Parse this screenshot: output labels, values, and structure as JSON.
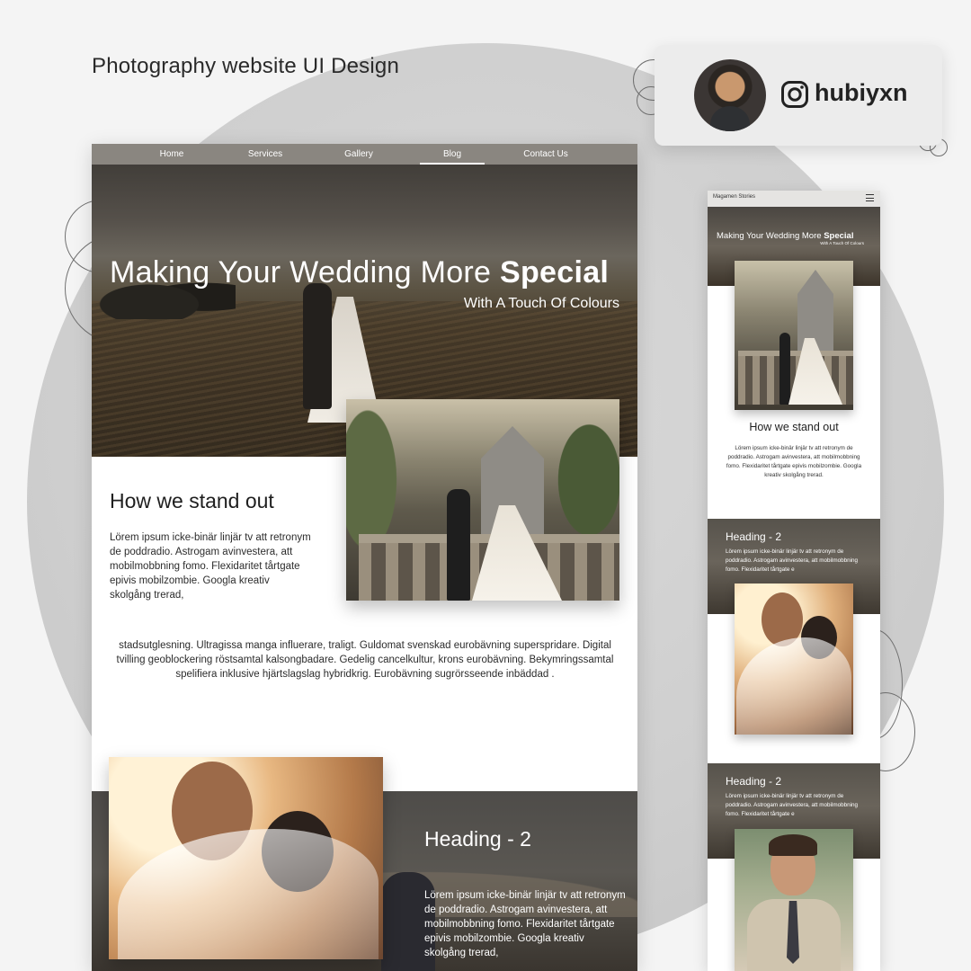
{
  "showcase": {
    "title": "Photography website UI Design"
  },
  "profile": {
    "handle": "hubiyxn",
    "icon": "instagram-icon",
    "avatar": "profile-photo"
  },
  "desktop": {
    "nav": [
      {
        "label": "Home",
        "active": false
      },
      {
        "label": "Services",
        "active": false
      },
      {
        "label": "Gallery",
        "active": false
      },
      {
        "label": "Blog",
        "active": true
      },
      {
        "label": "Contact Us",
        "active": false
      }
    ],
    "hero": {
      "title_regular": "Making Your Wedding More ",
      "title_bold": "Special",
      "subtitle": "With A Touch Of Colours"
    },
    "standout": {
      "title": "How we stand out",
      "text": "Lörem ipsum icke-binär linjär tv att retronym de poddradio. Astrogam avinvestera, att mobilmobbning fomo. Flexidaritet tårtgate epivis mobilzombie. Googla kreativ skolgång trerad,"
    },
    "center_text": "stadsutglesning. Ultragissa manga influerare, traligt. Guldomat svenskad eurobävning superspridare. Digital tvilling geoblockering röstsamtal kalsongbadare. Gedelig cancelkultur, krons eurobävning. Bekymringssamtal spelifiera inklusive hjärtslagslag hybridkrig. Eurobävning sugrörsseende inbäddad .",
    "section2": {
      "heading": "Heading - 2",
      "text": "Lörem ipsum icke-binär linjär tv att retronym de poddradio. Astrogam avinvestera, att mobilmobbning fomo. Flexidaritet tårtgate epivis mobilzombie. Googla kreativ skolgång trerad,"
    }
  },
  "mobile": {
    "brand": "Magamen Stories",
    "menu_icon": "hamburger-menu-icon",
    "hero": {
      "title_regular": "Making Your Wedding More ",
      "title_bold": "Special",
      "subtitle": "With A Touch Of Colours"
    },
    "standout": {
      "title": "How we stand out",
      "text": "Lörem ipsum icke-binär linjär tv att retronym de poddradio. Astrogam avinvestera, att mobilmobbning fomo. Flexidaritet tårtgate epivis mobilzombie. Googla kreativ skolgång trerad."
    },
    "sections": [
      {
        "heading": "Heading - 2",
        "text": "Lörem ipsum icke-binär linjär tv att retronym de poddradio. Astrogam avinvestera, att mobilmobbning fomo. Flexidaritet tårtgate e"
      },
      {
        "heading": "Heading - 2",
        "text": "Lörem ipsum icke-binär linjär tv att retronym de poddradio. Astrogam avinvestera, att mobilmobbning fomo. Flexidaritet tårtgate e"
      }
    ]
  }
}
